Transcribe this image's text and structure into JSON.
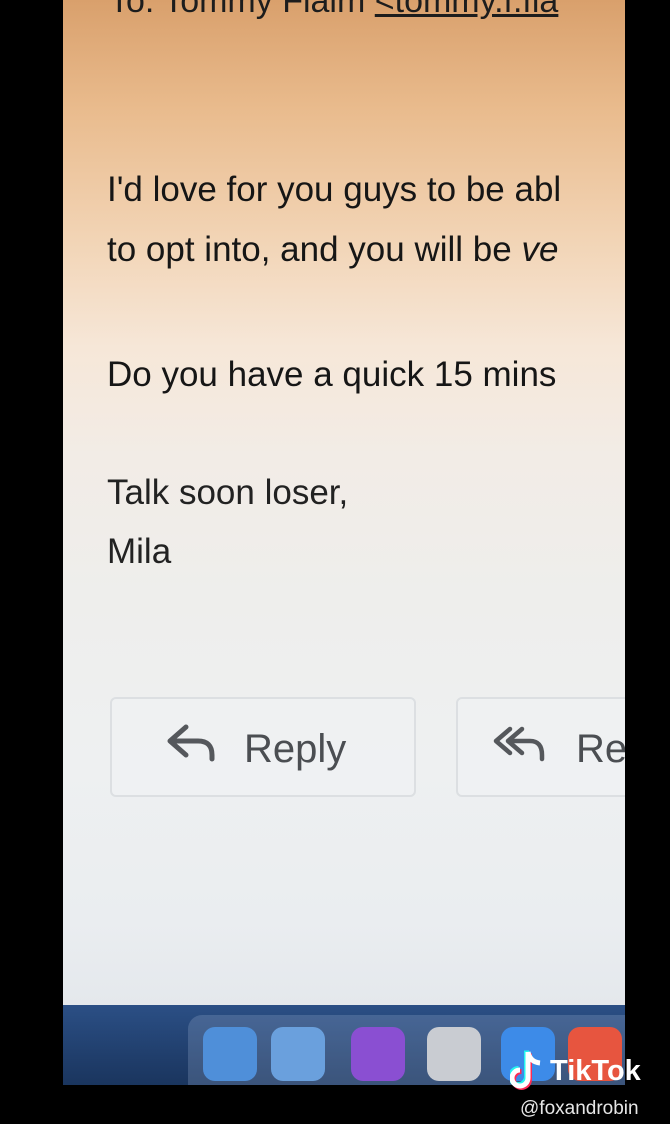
{
  "email": {
    "to_label": "To:",
    "to_name": "Tommy Flaim",
    "to_address_fragment": "<tommy.f.fla",
    "body_line_1": "I'd love for you guys to be abl",
    "body_line_2_start": "to opt into, and you will be ",
    "body_line_2_italic": "ve",
    "body_line_3": "Do you have a quick 15 mins",
    "signoff": "Talk soon loser,",
    "signature": "Mila"
  },
  "actions": {
    "reply_label": "Reply",
    "reply_all_label_fragment": "Re"
  },
  "dock": {
    "icons": [
      {
        "name": "finder-icon",
        "color": "#4f8fd9"
      },
      {
        "name": "mail-icon",
        "color": "#6aa0dd"
      },
      {
        "name": "siri-icon",
        "color": "#8a4fd2"
      },
      {
        "name": "launchpad-icon",
        "color": "#c9ccd2"
      },
      {
        "name": "safari-icon",
        "color": "#3d8be8"
      },
      {
        "name": "chrome-icon",
        "color": "#e7553f"
      }
    ]
  },
  "overlay": {
    "tiktok_brand": "TikTok",
    "tiktok_handle": "@foxandrobin"
  }
}
